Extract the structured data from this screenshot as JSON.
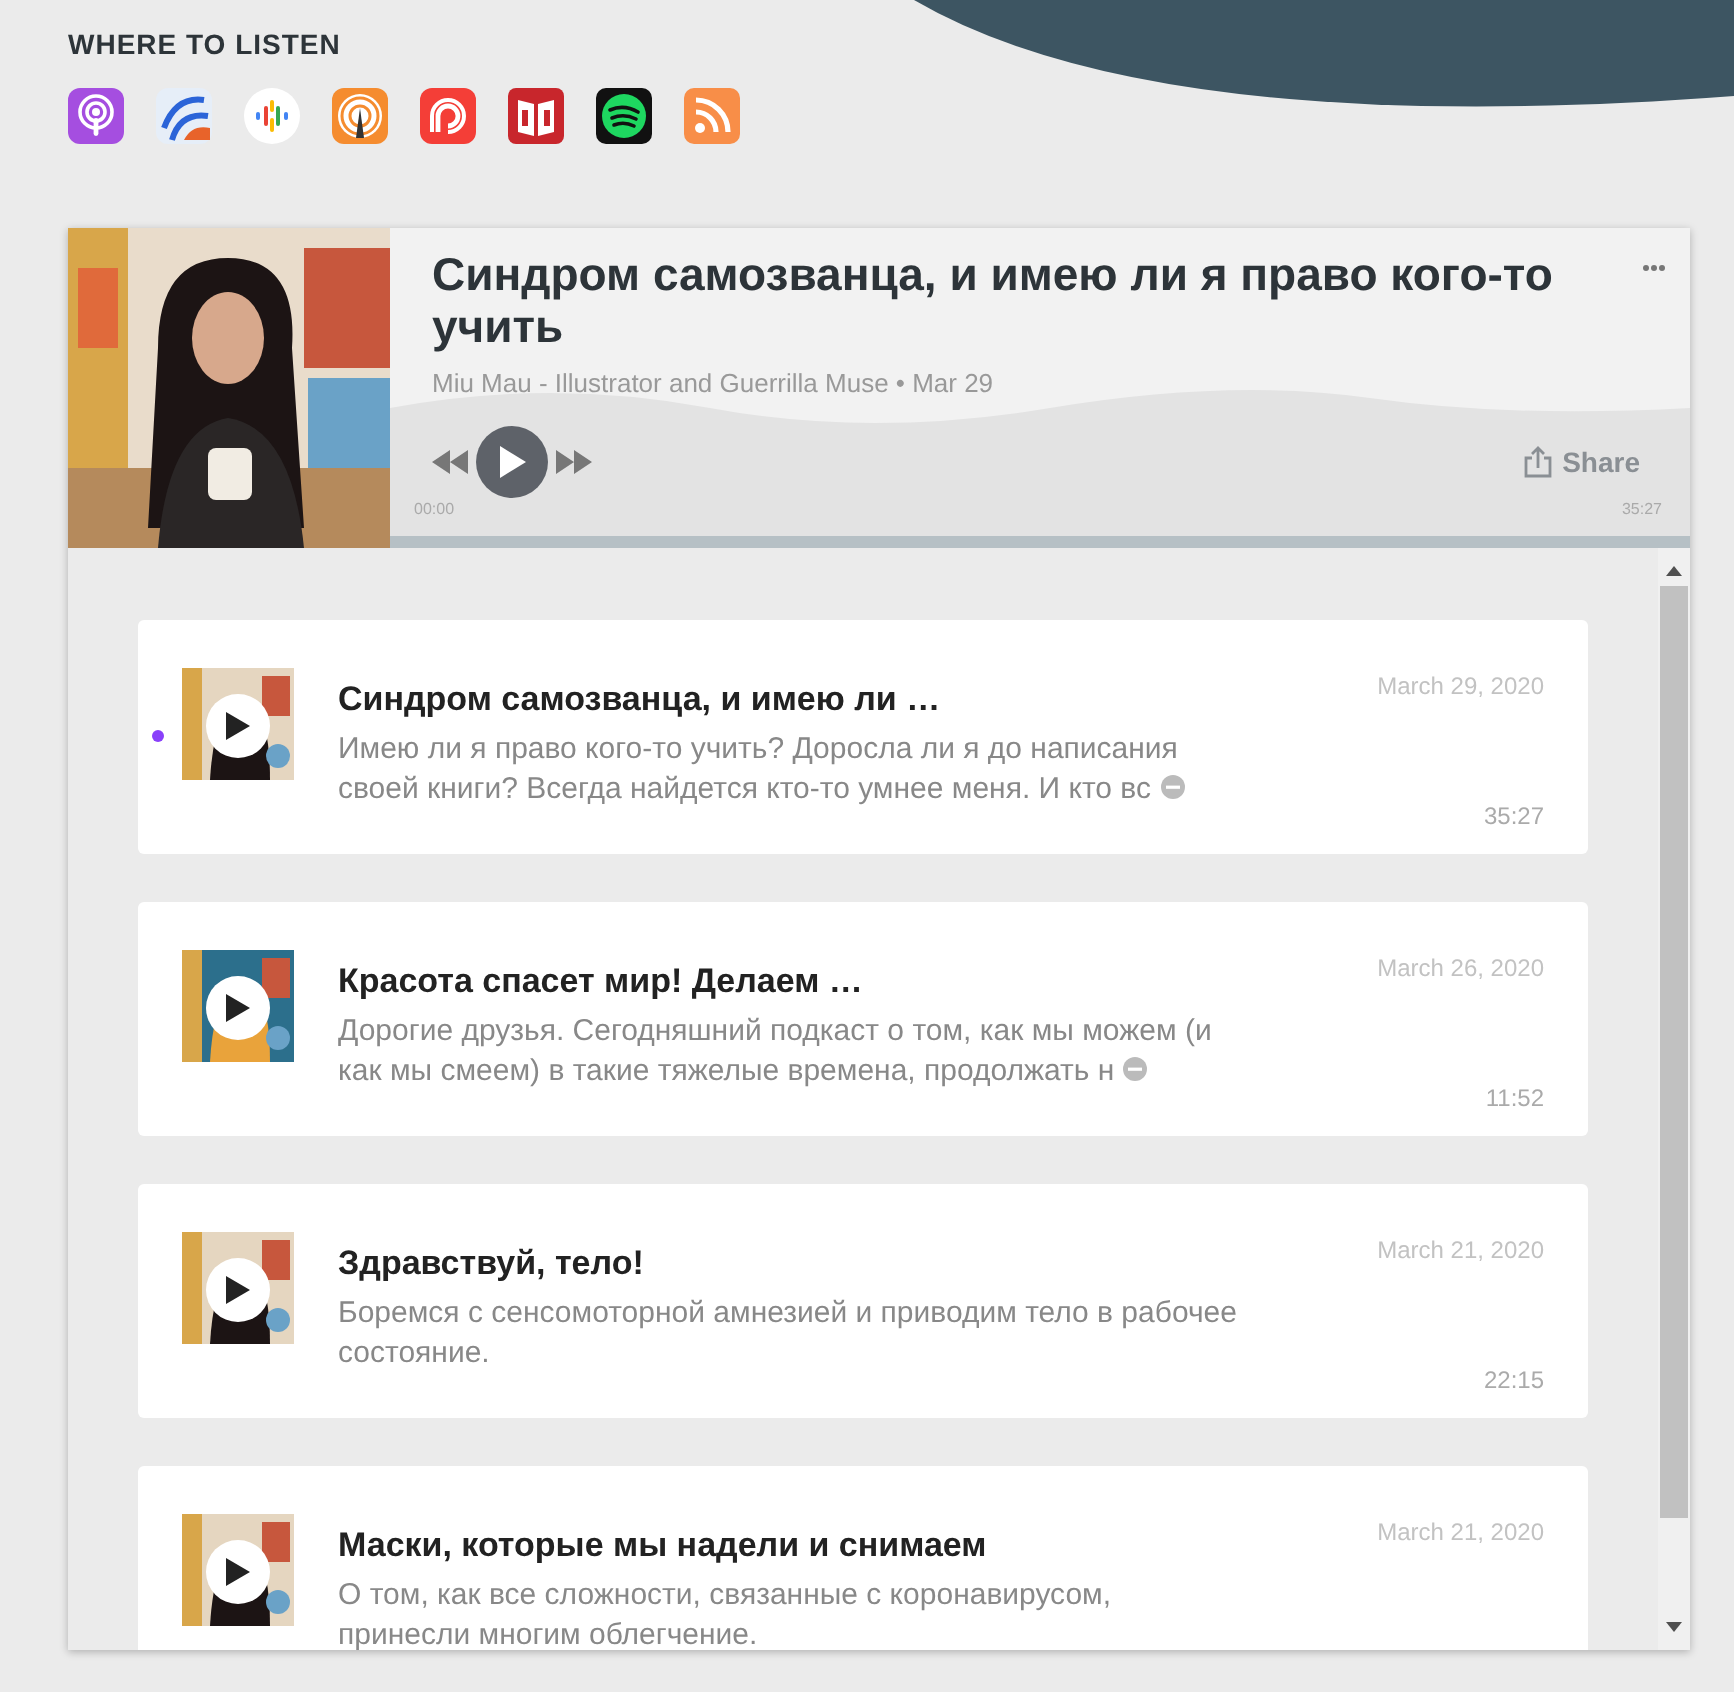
{
  "section_title": "WHERE TO LISTEN",
  "player": {
    "title": "Синдром самозванца, и имею ли я право кого-то учить",
    "meta": "Miu Mau - Illustrator and Guerrilla Muse • Mar 29",
    "share": "Share",
    "time_start": "00:00",
    "time_end": "35:27"
  },
  "episodes": [
    {
      "title": "Синдром самозванца, и имею ли …",
      "description": "Имею ли я право кого-то  учить? Доросла ли я до написания своей книги? Всегда найдется кто-то умнее меня. И кто вс",
      "truncated": true,
      "date": "March 29, 2020",
      "duration": "35:27",
      "playing": true
    },
    {
      "title": "Красота спасет мир! Делаем …",
      "description": "Дорогие друзья. Сегодняшний подкаст о том, как мы можем (и как мы смеем) в такие тяжелые времена, продолжать н",
      "truncated": true,
      "date": "March 26, 2020",
      "duration": "11:52",
      "playing": false
    },
    {
      "title": "Здравствуй, тело!",
      "description": "Боремся с сенсомоторной амнезией и приводим тело в рабочее состояние.",
      "truncated": false,
      "date": "March 21, 2020",
      "duration": "22:15",
      "playing": false
    },
    {
      "title": "Маски, которые мы надели и снимаем",
      "description": "О том, как все сложности, связанные с коронавирусом, принесли многим облегчение.",
      "truncated": false,
      "date": "March 21, 2020",
      "playing": false
    }
  ]
}
